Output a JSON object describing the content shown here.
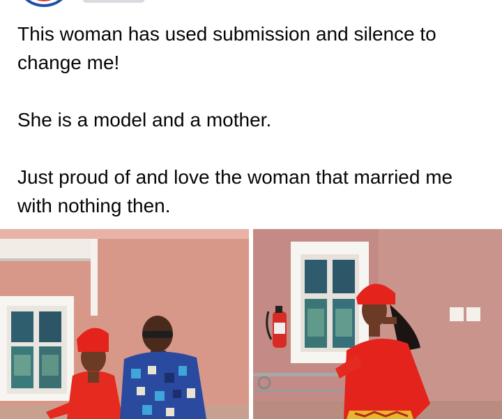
{
  "post": {
    "paragraphs": [
      "This woman has used submission and silence to change me!",
      "She is a model and a mother.",
      "Just proud of and love the woman that married me with nothing then."
    ]
  },
  "photos": [
    {
      "label": "couple-photo"
    },
    {
      "label": "woman-photo"
    }
  ],
  "colors": {
    "text": "#050505",
    "wall": "#d99a8c",
    "dress": "#e3231c",
    "avatar_ring": "#1f4fa8"
  }
}
